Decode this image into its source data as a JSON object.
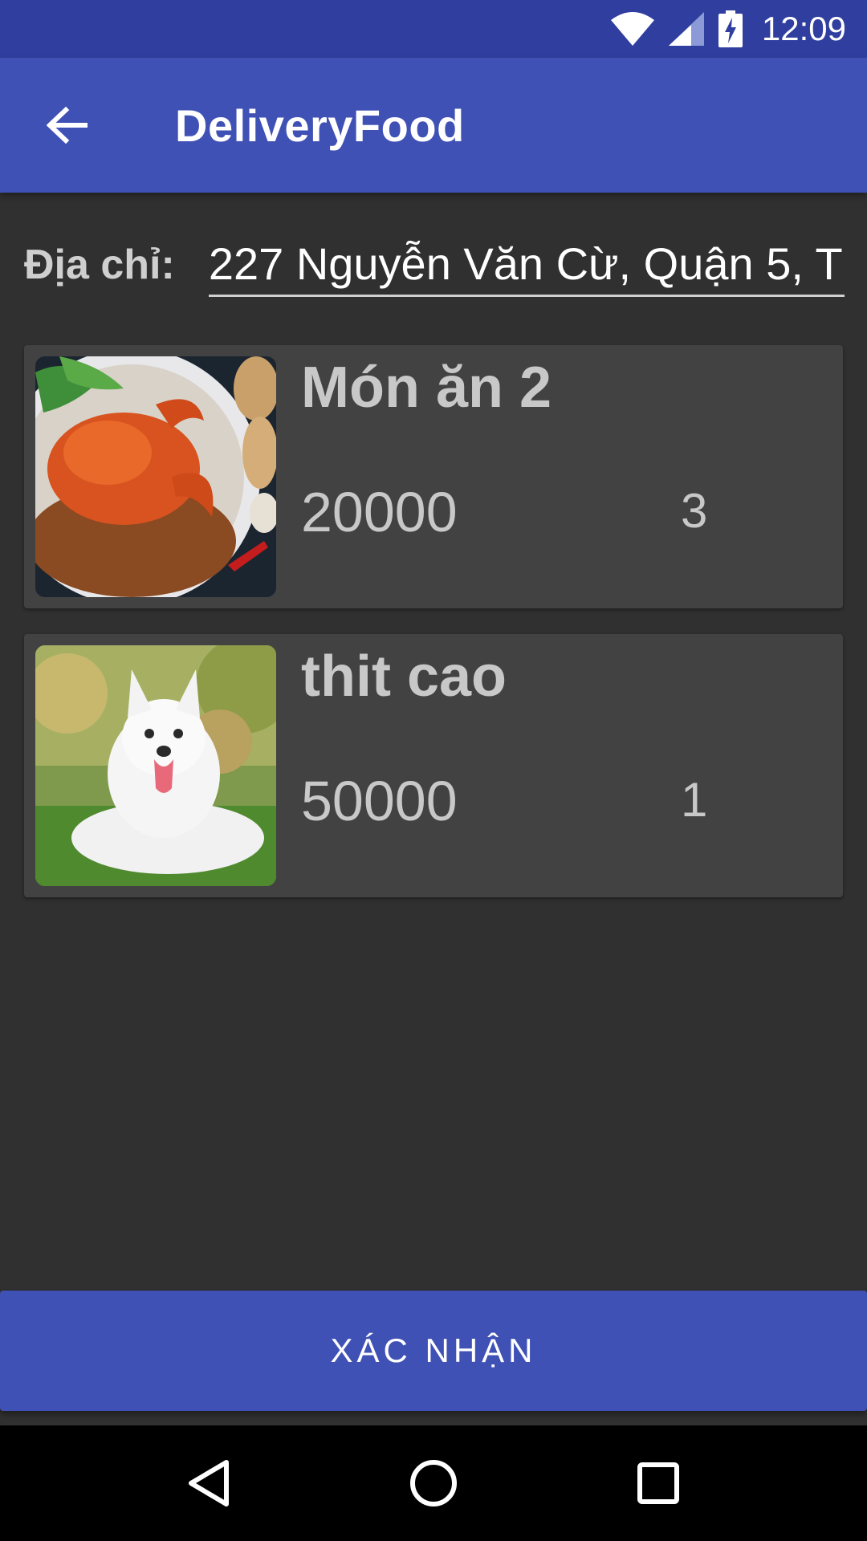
{
  "status_bar": {
    "time": "12:09",
    "icons": [
      "wifi-icon",
      "signal-icon",
      "battery-charging-icon"
    ]
  },
  "app_bar": {
    "title": "DeliveryFood",
    "back_icon": "arrow-back-icon"
  },
  "address": {
    "label": "Địa chỉ:",
    "value": "227 Nguyễn Văn Cừ, Quận 5, T"
  },
  "cart": {
    "items": [
      {
        "name": "Món ăn 2",
        "price": "20000",
        "quantity": "3",
        "image": "crab-dish-photo"
      },
      {
        "name": "thit cao",
        "price": "50000",
        "quantity": "1",
        "image": "white-dog-photo"
      }
    ]
  },
  "confirm_button": {
    "label": "XÁC NHẬN"
  },
  "nav_bar": {
    "icons": [
      "back-triangle-icon",
      "home-circle-icon",
      "recents-square-icon"
    ]
  },
  "colors": {
    "primary": "#3f51b5",
    "primary_dark": "#303f9f",
    "background": "#303030",
    "card": "#424242"
  }
}
